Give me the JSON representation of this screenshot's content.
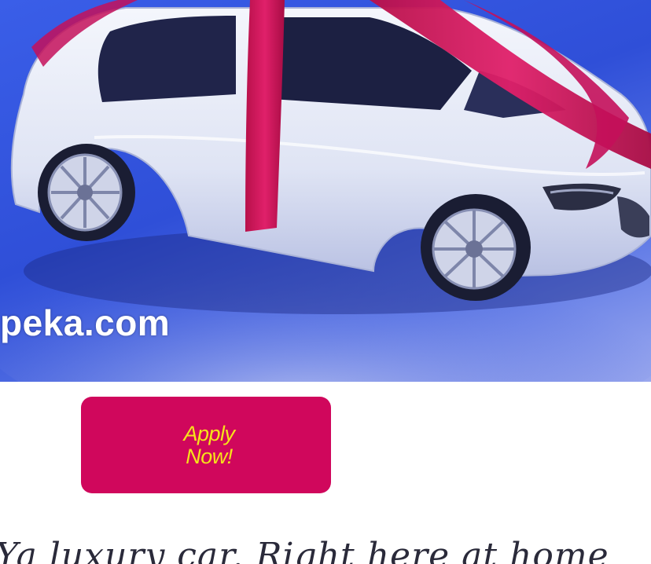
{
  "hero": {
    "caption": "peka.com"
  },
  "cta": {
    "line1": "Apply",
    "line2": "Now!"
  },
  "tagline": {
    "text": "Ya luxury car. Right here at home"
  },
  "colors": {
    "cta_background": "#d0075c",
    "cta_text": "#f6e31a",
    "ribbon": "#d4145a",
    "car_body": "#e8ecf6",
    "hero_background": "#3a5ee8"
  }
}
